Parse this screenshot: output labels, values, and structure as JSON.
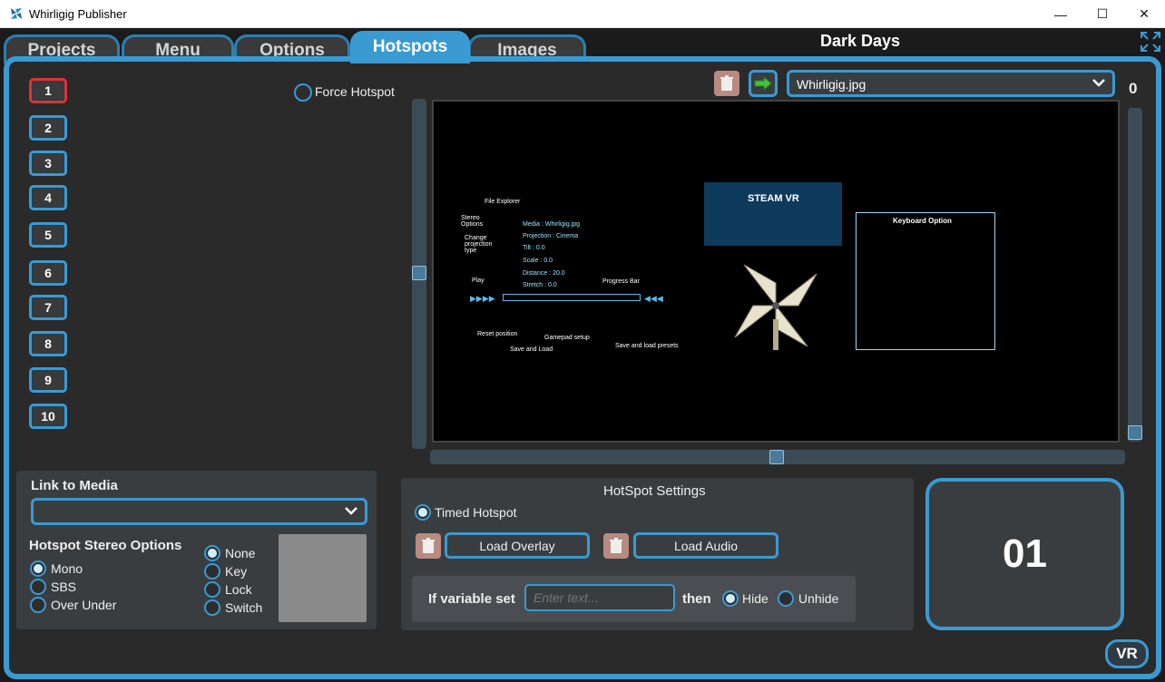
{
  "window": {
    "title": "Whirligig Publisher",
    "minimize": "—",
    "maximize": "☐",
    "close": "✕"
  },
  "tabs": [
    {
      "label": "Projects"
    },
    {
      "label": "Menu"
    },
    {
      "label": "Options"
    },
    {
      "label": "Hotspots"
    },
    {
      "label": "Images"
    }
  ],
  "project_title": "Dark Days",
  "hotspots": [
    "1",
    "2",
    "3",
    "4",
    "5",
    "6",
    "7",
    "8",
    "9",
    "10"
  ],
  "force_hotspot": {
    "label": "Force Hotspot",
    "checked": false
  },
  "image_dropdown": {
    "value": "Whirligig.jpg"
  },
  "image_count": "0",
  "preview": {
    "file_explorer": "File Explorer",
    "stereo_options": "Stereo Options",
    "change_projection": "Change projection type",
    "media": "Media : Whirligig.jpg",
    "projection": "Projection : Cinema",
    "tilt": "Tilt : 0.0",
    "scale": "Scale : 0.0",
    "distance": "Distance : 20.0",
    "stretch": "Stretch : 0.0",
    "play": "Play",
    "progress_bar": "Progress Bar",
    "reset_position": "Reset position",
    "save_and_load": "Save and Load",
    "gamepad_setup": "Gamepad setup",
    "save_load_presets": "Save and load presets",
    "steamvr": "STEAM VR",
    "keyboard_title": "Keyboard Option"
  },
  "link_to_media": {
    "label": "Link to Media",
    "value": ""
  },
  "stereo": {
    "label": "Hotspot Stereo Options",
    "modes": [
      {
        "label": "Mono",
        "checked": true
      },
      {
        "label": "SBS",
        "checked": false
      },
      {
        "label": "Over Under",
        "checked": false
      }
    ],
    "types": [
      {
        "label": "None",
        "checked": true
      },
      {
        "label": "Key",
        "checked": false
      },
      {
        "label": "Lock",
        "checked": false
      },
      {
        "label": "Switch",
        "checked": false
      }
    ]
  },
  "hotspot_settings": {
    "title": "HotSpot Settings",
    "timed_hotspot": "Timed Hotspot",
    "load_overlay": "Load Overlay",
    "load_audio": "Load Audio",
    "if_variable_set": "If variable set",
    "variable_placeholder": "Enter text...",
    "then": "then",
    "hide": "Hide",
    "unhide": "Unhide"
  },
  "hotspot_number": "01",
  "vr_button": "VR",
  "colors": {
    "accent": "#3a9ad2",
    "selected": "#e53030",
    "panel": "#3a3d40"
  }
}
